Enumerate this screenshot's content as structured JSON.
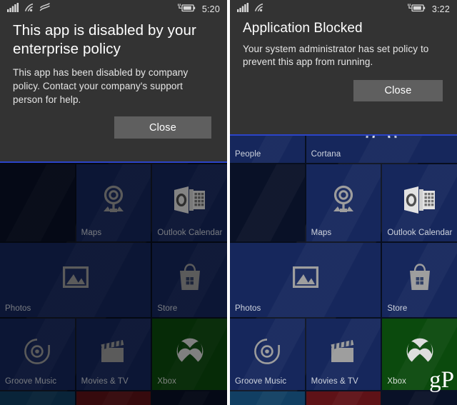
{
  "panels": [
    {
      "id": "left",
      "statusbar": {
        "icons": [
          "signal-bars-icon",
          "wifi-icon",
          "data-waves-icon"
        ],
        "battery_icon": "battery-charging-icon",
        "time": "5:20"
      },
      "dialog": {
        "title": "This app is disabled by your enterprise policy",
        "body": "This app has been disabled by company policy. Contact your company's support person for help.",
        "close_label": "Close"
      },
      "tiles": [
        {
          "label": "",
          "icon": "none",
          "span": 1,
          "style": "empty"
        },
        {
          "label": "Maps",
          "icon": "maps-icon",
          "span": 1,
          "style": "blue"
        },
        {
          "label": "Outlook Calendar",
          "icon": "outlook-cal-icon",
          "span": 1,
          "style": "blue"
        },
        {
          "label": "Photos",
          "icon": "photos-icon",
          "span": 2,
          "style": "blue"
        },
        {
          "label": "Store",
          "icon": "store-icon",
          "span": 1,
          "style": "blue"
        },
        {
          "label": "Groove Music",
          "icon": "groove-icon",
          "span": 1,
          "style": "blue"
        },
        {
          "label": "Movies & TV",
          "icon": "movies-icon",
          "span": 1,
          "style": "blue"
        },
        {
          "label": "Xbox",
          "icon": "xbox-icon",
          "span": 1,
          "style": "green"
        },
        {
          "label": "",
          "icon": "none",
          "span": 1,
          "style": "blue-dk"
        },
        {
          "label": "",
          "icon": "none",
          "span": 1,
          "style": "red-dk"
        },
        {
          "label": "",
          "icon": "none",
          "span": 1,
          "style": "empty"
        }
      ]
    },
    {
      "id": "right",
      "statusbar": {
        "icons": [
          "signal-bars-icon",
          "wifi-icon"
        ],
        "battery_icon": "battery-charging-icon",
        "time": "3:22"
      },
      "dialog": {
        "title": "Application Blocked",
        "body": "Your system administrator has set policy to prevent this app from running.",
        "close_label": "Close"
      },
      "tiles": [
        {
          "label": "People",
          "icon": "people-icon",
          "span": 1,
          "style": "blue"
        },
        {
          "label": "Cortana",
          "icon": "cortana-icon",
          "span": 2,
          "style": "blue"
        },
        {
          "label": "",
          "icon": "none",
          "span": 1,
          "style": "empty"
        },
        {
          "label": "Maps",
          "icon": "maps-icon",
          "span": 1,
          "style": "blue"
        },
        {
          "label": "Outlook Calendar",
          "icon": "outlook-cal-icon",
          "span": 1,
          "style": "blue"
        },
        {
          "label": "Photos",
          "icon": "photos-icon",
          "span": 2,
          "style": "blue"
        },
        {
          "label": "Store",
          "icon": "store-icon",
          "span": 1,
          "style": "blue"
        },
        {
          "label": "Groove Music",
          "icon": "groove-icon",
          "span": 1,
          "style": "blue"
        },
        {
          "label": "Movies & TV",
          "icon": "movies-icon",
          "span": 1,
          "style": "blue"
        },
        {
          "label": "Xbox",
          "icon": "xbox-icon",
          "span": 1,
          "style": "green"
        },
        {
          "label": "",
          "icon": "none",
          "span": 1,
          "style": "blue-dk"
        },
        {
          "label": "",
          "icon": "none",
          "span": 1,
          "style": "red-dk"
        },
        {
          "label": "",
          "icon": "none",
          "span": 1,
          "style": "empty"
        }
      ]
    }
  ],
  "watermark": "gP",
  "colors": {
    "dialog_bg": "#333333",
    "button_bg": "#5f5f5f",
    "tile_blue": "#16275c",
    "tile_green": "#0b4a0d",
    "accent_line": "#2b44c9",
    "divider": "#ffffff"
  }
}
